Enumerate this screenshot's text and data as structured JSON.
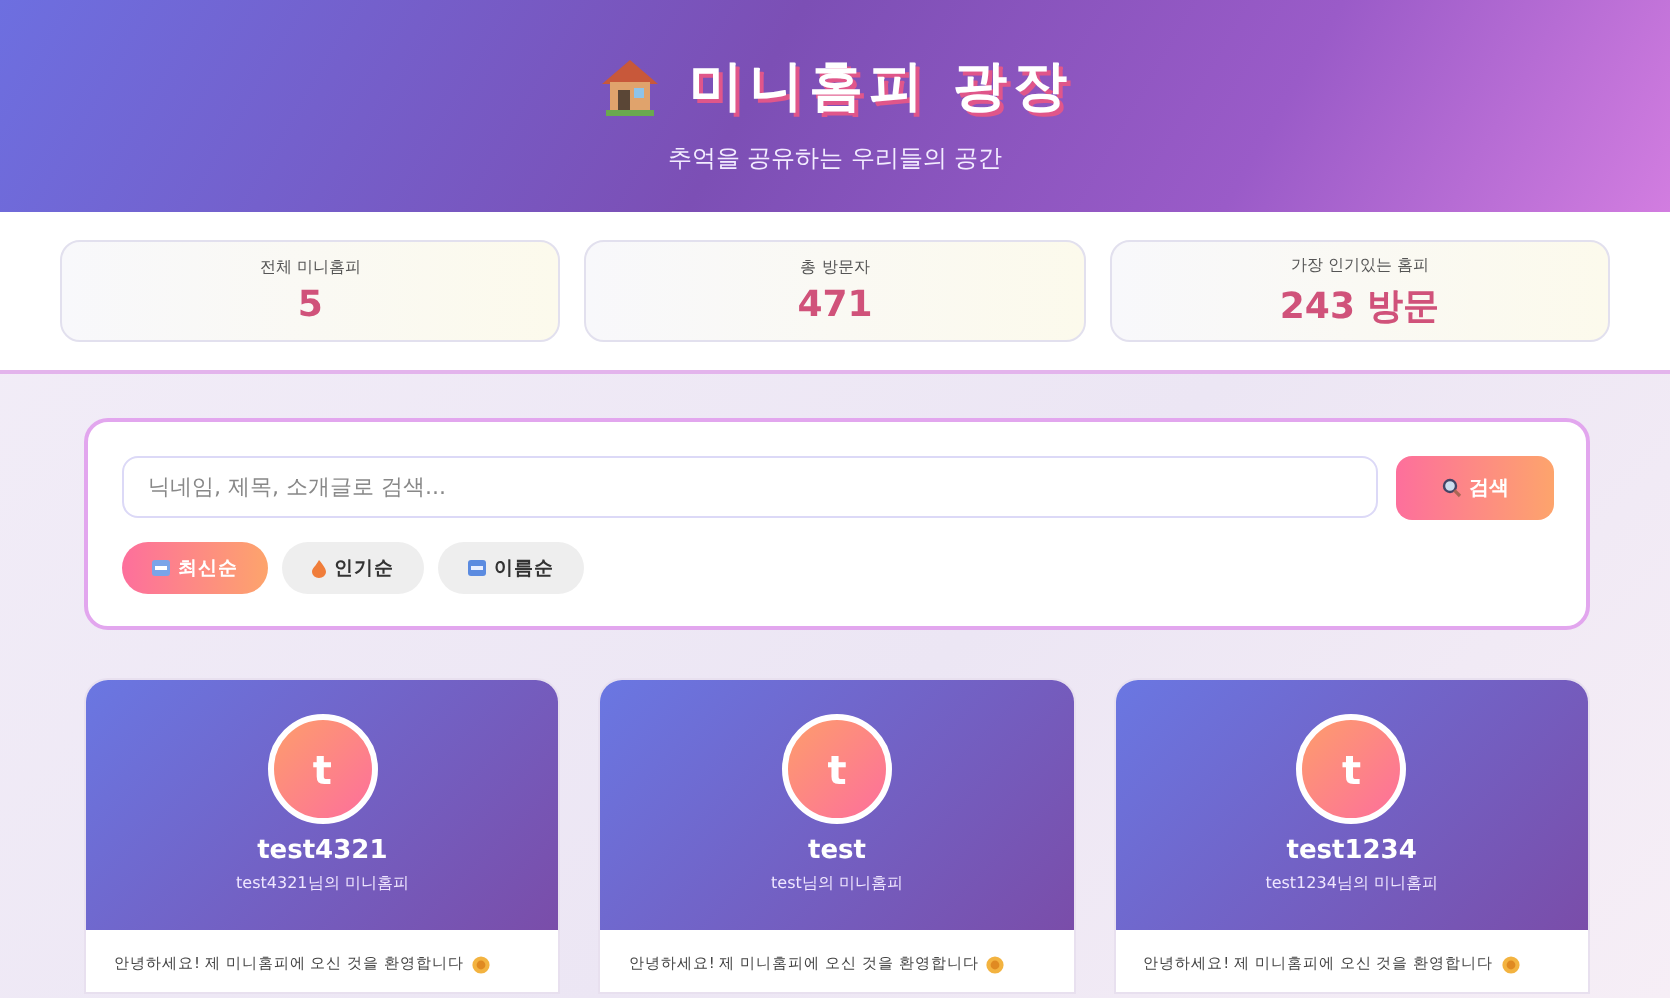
{
  "header": {
    "title": "미니홈피 광장",
    "subtitle": "추억을 공유하는 우리들의 공간"
  },
  "stats": [
    {
      "label": "전체 미니홈피",
      "value": "5"
    },
    {
      "label": "총 방문자",
      "value": "471"
    },
    {
      "label": "가장 인기있는 홈피",
      "value": "243 방문"
    }
  ],
  "search": {
    "placeholder": "닉네임, 제목, 소개글로 검색...",
    "button": "검색"
  },
  "sort_options": [
    {
      "label": "최신순",
      "kind": "new",
      "selected": true
    },
    {
      "label": "인기순",
      "kind": "fire",
      "selected": false
    },
    {
      "label": "이름순",
      "kind": "abc",
      "selected": false
    }
  ],
  "homepages": [
    {
      "avatar": "t",
      "name": "test4321",
      "subtitle": "test4321님의 미니홈피",
      "intro": "안녕하세요! 제 미니홈피에 오신 것을 환영합니다"
    },
    {
      "avatar": "t",
      "name": "test",
      "subtitle": "test님의 미니홈피",
      "intro": "안녕하세요! 제 미니홈피에 오신 것을 환영합니다"
    },
    {
      "avatar": "t",
      "name": "test1234",
      "subtitle": "test1234님의 미니홈피",
      "intro": "안녕하세요! 제 미니홈피에 오신 것을 환영합니다"
    }
  ]
}
